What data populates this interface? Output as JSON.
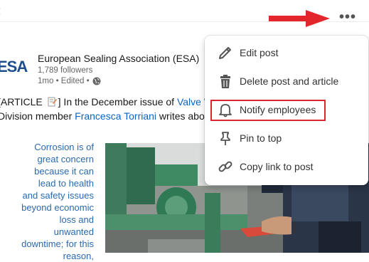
{
  "post": {
    "author_name": "European Sealing Association (ESA)",
    "logo_text": "ESA",
    "followers": "1,789 followers",
    "meta": "1mo • Edited •",
    "text_line1_prefix": "[ARTICLE ",
    "text_line1_mid": "] In the December issue of ",
    "text_line1_link": "Valve W",
    "text_line2_prefix": "Division member ",
    "text_line2_link": "Francesca Torriani",
    "text_line2_suffix": " writes abou",
    "quote": "Corrosion is of great concern because it can lead to health and safety issues beyond economic loss and unwanted downtime; for this reason,"
  },
  "more_button": {
    "label": "•••",
    "icon": "ellipsis-icon"
  },
  "menu": {
    "items": [
      {
        "label": "Edit post",
        "icon": "pencil-icon"
      },
      {
        "label": "Delete post and article",
        "icon": "trash-icon"
      },
      {
        "label": "Notify employees",
        "icon": "bell-icon"
      },
      {
        "label": "Pin to top",
        "icon": "pin-icon"
      },
      {
        "label": "Copy link to post",
        "icon": "link-icon"
      }
    ]
  },
  "colors": {
    "link": "#0a66c2",
    "quote": "#2a6ab0",
    "annotation": "#d9262f"
  }
}
